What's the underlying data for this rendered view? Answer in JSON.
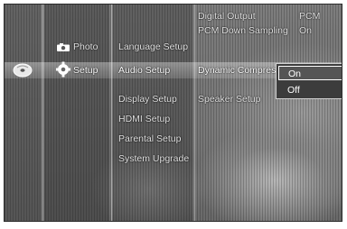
{
  "main_menu": {
    "photo_label": "Photo",
    "setup_label": "Setup"
  },
  "setup_menu": {
    "items": [
      "Language Setup",
      "Audio Setup",
      "Display Setup",
      "HDMI Setup",
      "Parental Setup",
      "System Upgrade"
    ],
    "selected_index": 1
  },
  "audio_settings": {
    "digital_output": {
      "label": "Digital Output",
      "value": "PCM"
    },
    "pcm_down_sampling": {
      "label": "PCM Down Sampling",
      "value": "On"
    },
    "dynamic_compression": {
      "label": "Dynamic Compression"
    },
    "speaker_setup": {
      "label": "Speaker Setup"
    }
  },
  "dropdown": {
    "options": [
      "On",
      "Off"
    ],
    "selected": "On"
  },
  "colors": {
    "background": "#6e6e6e",
    "text": "#ffffff",
    "highlight": "#d9d9d9",
    "dropdown_bg": "#3c3c3c"
  },
  "icons": {
    "disc": "disc-icon",
    "photo": "camera-icon",
    "setup": "gear-icon"
  }
}
